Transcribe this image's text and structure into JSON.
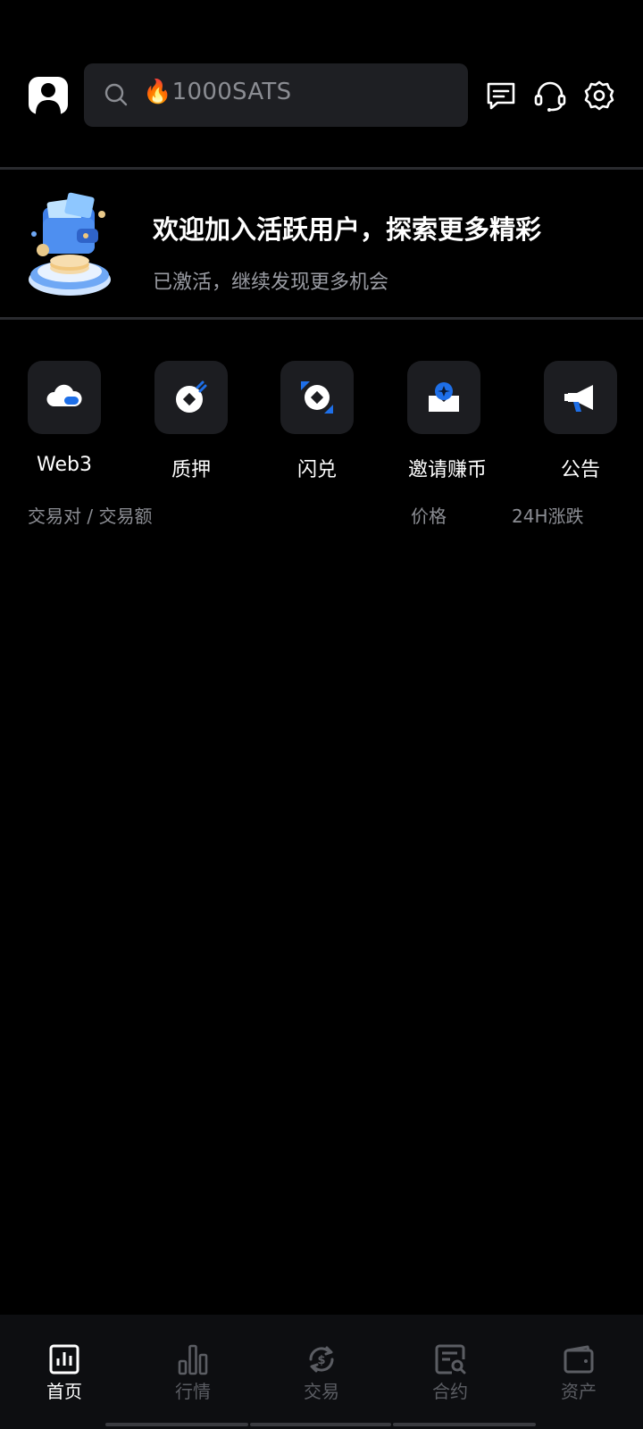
{
  "header": {
    "search_placeholder": "🔥1000SATS",
    "icons": [
      "avatar-icon",
      "search-icon",
      "message-icon",
      "headset-icon",
      "settings-icon"
    ]
  },
  "banner": {
    "title": "欢迎加入活跃用户，探索更多精彩",
    "subtitle": "已激活，继续发现更多机会"
  },
  "quick_actions": [
    {
      "label": "Web3",
      "icon": "web3-cloud-icon"
    },
    {
      "label": "质押",
      "icon": "stake-icon"
    },
    {
      "label": "闪兑",
      "icon": "swap-icon"
    },
    {
      "label": "邀请赚币",
      "icon": "invite-icon"
    },
    {
      "label": "公告",
      "icon": "megaphone-icon"
    }
  ],
  "market_table": {
    "columns": [
      "交易对 / 交易额",
      "价格",
      "24H涨跌"
    ]
  },
  "tabbar": {
    "tabs": [
      {
        "label": "首页",
        "icon": "home-chart-icon",
        "active": true
      },
      {
        "label": "行情",
        "icon": "bar-chart-icon",
        "active": false
      },
      {
        "label": "交易",
        "icon": "exchange-icon",
        "active": false
      },
      {
        "label": "合约",
        "icon": "contract-icon",
        "active": false
      },
      {
        "label": "资产",
        "icon": "wallet-icon",
        "active": false
      }
    ]
  },
  "colors": {
    "background": "#000000",
    "surface": "#1e1f23",
    "accent_blue": "#1e6fe8",
    "muted_text": "#8b8d93"
  }
}
